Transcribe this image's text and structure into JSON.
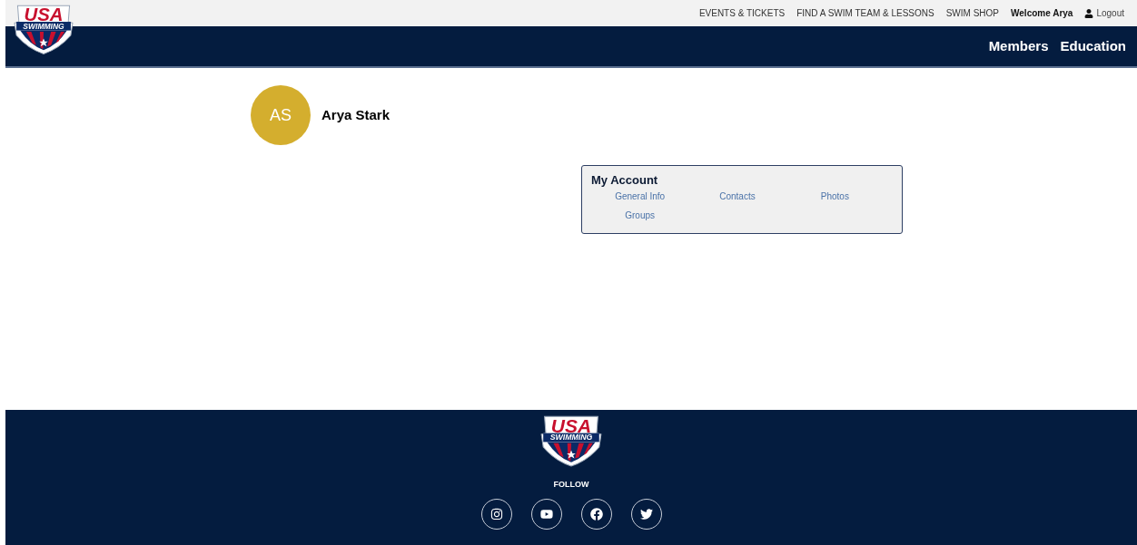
{
  "logo": {
    "top": "USA",
    "bottom": "SWIMMING"
  },
  "top_links": [
    {
      "label": "EVENTS & TICKETS",
      "kind": "link"
    },
    {
      "label": "FIND A SWIM TEAM & LESSONS",
      "kind": "link"
    },
    {
      "label": "SWIM SHOP",
      "kind": "link"
    },
    {
      "label": "Welcome Arya",
      "kind": "greeting"
    },
    {
      "label": "Logout",
      "kind": "logout"
    }
  ],
  "main_nav": [
    "Members",
    "Education"
  ],
  "profile": {
    "initials": "AS",
    "name": "Arya Stark"
  },
  "account": {
    "title": "My Account",
    "links": [
      "General Info",
      "Contacts",
      "Photos",
      "Groups"
    ]
  },
  "footer": {
    "logo": {
      "top": "USA",
      "bottom": "SWIMMING"
    },
    "follow": "FOLLOW",
    "social": [
      {
        "kind": "instagram"
      },
      {
        "kind": "youtube"
      },
      {
        "kind": "facebook"
      },
      {
        "kind": "twitter"
      }
    ]
  }
}
